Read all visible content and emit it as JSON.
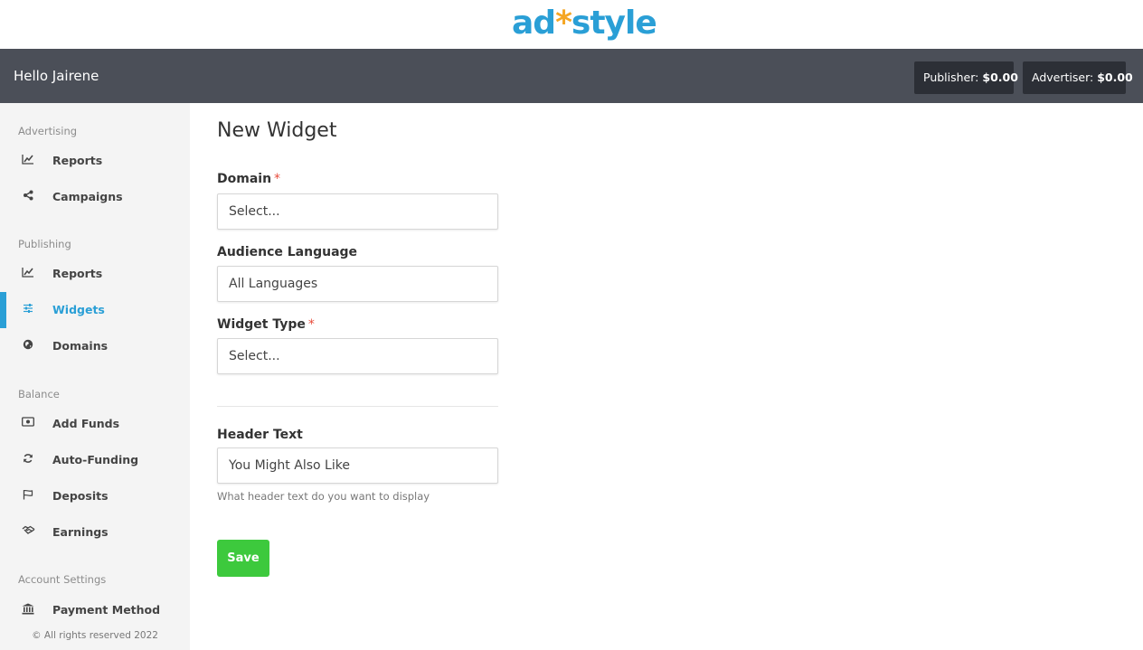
{
  "brand": {
    "logo_part1": "ad",
    "logo_dot": "*",
    "logo_part2": "style"
  },
  "topbar": {
    "greeting": "Hello Jairene",
    "publisher_label": "Publisher:",
    "publisher_value": "$0.00",
    "advertiser_label": "Advertiser:",
    "advertiser_value": "$0.00"
  },
  "sidebar": {
    "sections": {
      "advertising": "Advertising",
      "publishing": "Publishing",
      "balance": "Balance",
      "account": "Account Settings"
    },
    "items": {
      "adv_reports": {
        "label": "Reports",
        "icon": "line-chart-icon"
      },
      "campaigns": {
        "label": "Campaigns",
        "icon": "share-icon"
      },
      "pub_reports": {
        "label": "Reports",
        "icon": "line-chart-icon"
      },
      "widgets": {
        "label": "Widgets",
        "icon": "sliders-icon",
        "active": true
      },
      "domains": {
        "label": "Domains",
        "icon": "globe-icon"
      },
      "add_funds": {
        "label": "Add Funds",
        "icon": "money-icon"
      },
      "auto_funding": {
        "label": "Auto-Funding",
        "icon": "refresh-icon"
      },
      "deposits": {
        "label": "Deposits",
        "icon": "flag-icon"
      },
      "earnings": {
        "label": "Earnings",
        "icon": "handshake-icon"
      },
      "payment_method": {
        "label": "Payment Method",
        "icon": "bank-icon"
      }
    },
    "copyright": "© All rights reserved 2022"
  },
  "form": {
    "title": "New Widget",
    "domain_label": "Domain",
    "domain_value": "Select...",
    "language_label": "Audience Language",
    "language_value": "All Languages",
    "widget_type_label": "Widget Type",
    "widget_type_value": "Select...",
    "header_text_label": "Header Text",
    "header_text_value": "You Might Also Like",
    "header_text_help": "What header text do you want to display",
    "required_mark": "*",
    "save_label": "Save"
  },
  "colors": {
    "accent": "#2a9fd6",
    "save": "#3dc93d",
    "topbar": "#4b4f58",
    "required": "#e74c3c"
  }
}
